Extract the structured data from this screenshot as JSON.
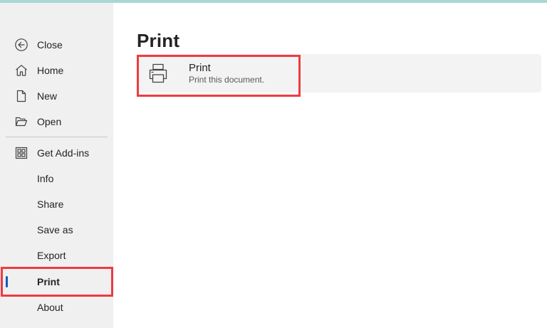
{
  "sidebar": {
    "items": [
      {
        "label": "Close",
        "icon": "back-arrow-icon"
      },
      {
        "label": "Home",
        "icon": "home-icon"
      },
      {
        "label": "New",
        "icon": "new-document-icon"
      },
      {
        "label": "Open",
        "icon": "folder-open-icon"
      },
      {
        "label": "Get Add-ins",
        "icon": "add-ins-grid-icon"
      },
      {
        "label": "Info"
      },
      {
        "label": "Share"
      },
      {
        "label": "Save as"
      },
      {
        "label": "Export"
      },
      {
        "label": "Print",
        "selected": true
      },
      {
        "label": "About"
      }
    ]
  },
  "main": {
    "title": "Print",
    "print_option": {
      "title": "Print",
      "subtitle": "Print this document.",
      "icon": "printer-icon"
    }
  },
  "colors": {
    "highlight_box": "#ee3b41",
    "selection_indicator": "#185abd",
    "sidebar_bg": "#f0f0f0",
    "top_strip": "#a9d7d6"
  }
}
